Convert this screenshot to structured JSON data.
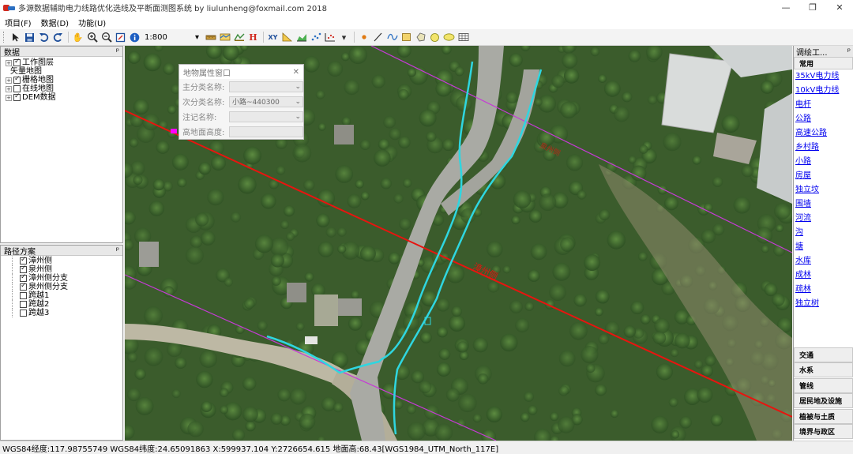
{
  "window": {
    "title": "多源数据辅助电力线路优化选线及平断面测图系统 by liulunheng@foxmail.com 2018",
    "minimize_glyph": "—",
    "restore_glyph": "❐",
    "close_glyph": "✕"
  },
  "menu": [
    "项目(F)",
    "数据(D)",
    "功能(U)"
  ],
  "toolbar": {
    "scale": "1:800",
    "dropdown_glyph": "▾",
    "icons": [
      "pointer-icon",
      "save-icon",
      "undo-icon",
      "redo-icon",
      "pan-hand-icon",
      "zoom-in-icon",
      "zoom-out-icon",
      "full-extent-icon",
      "info-icon",
      "scale-combo",
      "measure-icon",
      "profile-icon",
      "section-icon",
      "h-icon",
      "xy-icon",
      "triangle-icon",
      "area-chart-icon",
      "scatter-icon",
      "axis-chart-icon",
      "point-icon",
      "line-icon",
      "curve-icon",
      "rectangle-icon",
      "polygon-icon",
      "circle-icon",
      "ellipse-icon",
      "table-icon"
    ]
  },
  "data_panel": {
    "title": "数据",
    "pin": "ᵖ",
    "items": [
      {
        "label": "工作图层",
        "checked": true,
        "expander": "+",
        "indent": 0
      },
      {
        "label": "矢量地图",
        "checked": null,
        "expander": null,
        "indent": 1
      },
      {
        "label": "栅格地图",
        "checked": true,
        "expander": "+",
        "indent": 0
      },
      {
        "label": "在线地图",
        "checked": false,
        "expander": "+",
        "indent": 0
      },
      {
        "label": "DEM数据",
        "checked": true,
        "expander": "+",
        "indent": 0
      }
    ]
  },
  "route_panel": {
    "title": "路径方案",
    "pin": "ᵖ",
    "items": [
      {
        "label": "漳州侧",
        "checked": true
      },
      {
        "label": "泉州侧",
        "checked": true
      },
      {
        "label": "漳州侧分支",
        "checked": true
      },
      {
        "label": "泉州侧分支",
        "checked": true
      },
      {
        "label": "跨越1",
        "checked": false
      },
      {
        "label": "跨越2",
        "checked": false
      },
      {
        "label": "跨越3",
        "checked": false
      }
    ]
  },
  "attr_dialog": {
    "title": "地物属性窗口",
    "close_glyph": "✕",
    "rows": [
      {
        "label": "主分类名称:",
        "value": "",
        "has_dropdown": true
      },
      {
        "label": "次分类名称:",
        "value": "小路~440300",
        "has_dropdown": true
      },
      {
        "label": "注记名称:",
        "value": "",
        "has_dropdown": true
      },
      {
        "label": "高地面高度:",
        "value": "",
        "has_dropdown": false
      }
    ]
  },
  "map": {
    "route_label": "漳州侧",
    "route_label_2": "泉州侧",
    "colors": {
      "route": "#e8140f",
      "road": "#2fd6e0",
      "boundary": "#c63ad6"
    }
  },
  "survey_panel": {
    "title": "调绘工...",
    "pin": "ᵖ",
    "tab": "常用",
    "links": [
      "35kV电力线",
      "10kV电力线",
      "电杆",
      "公路",
      "高速公路",
      "乡村路",
      "小路",
      "房屋",
      "独立坟",
      "围墙",
      "河流",
      "沟",
      "塘",
      "水库",
      "成林",
      "疏林",
      "独立树"
    ],
    "categories": [
      "交通",
      "水系",
      "管线",
      "居民地及设施",
      "植被与土质",
      "境界与政区"
    ]
  },
  "status": "WGS84经度:117.98755749 WGS84纬度:24.65091863 X:599937.104 Y:2726654.615 地面高:68.43[WGS1984_UTM_North_117E]"
}
